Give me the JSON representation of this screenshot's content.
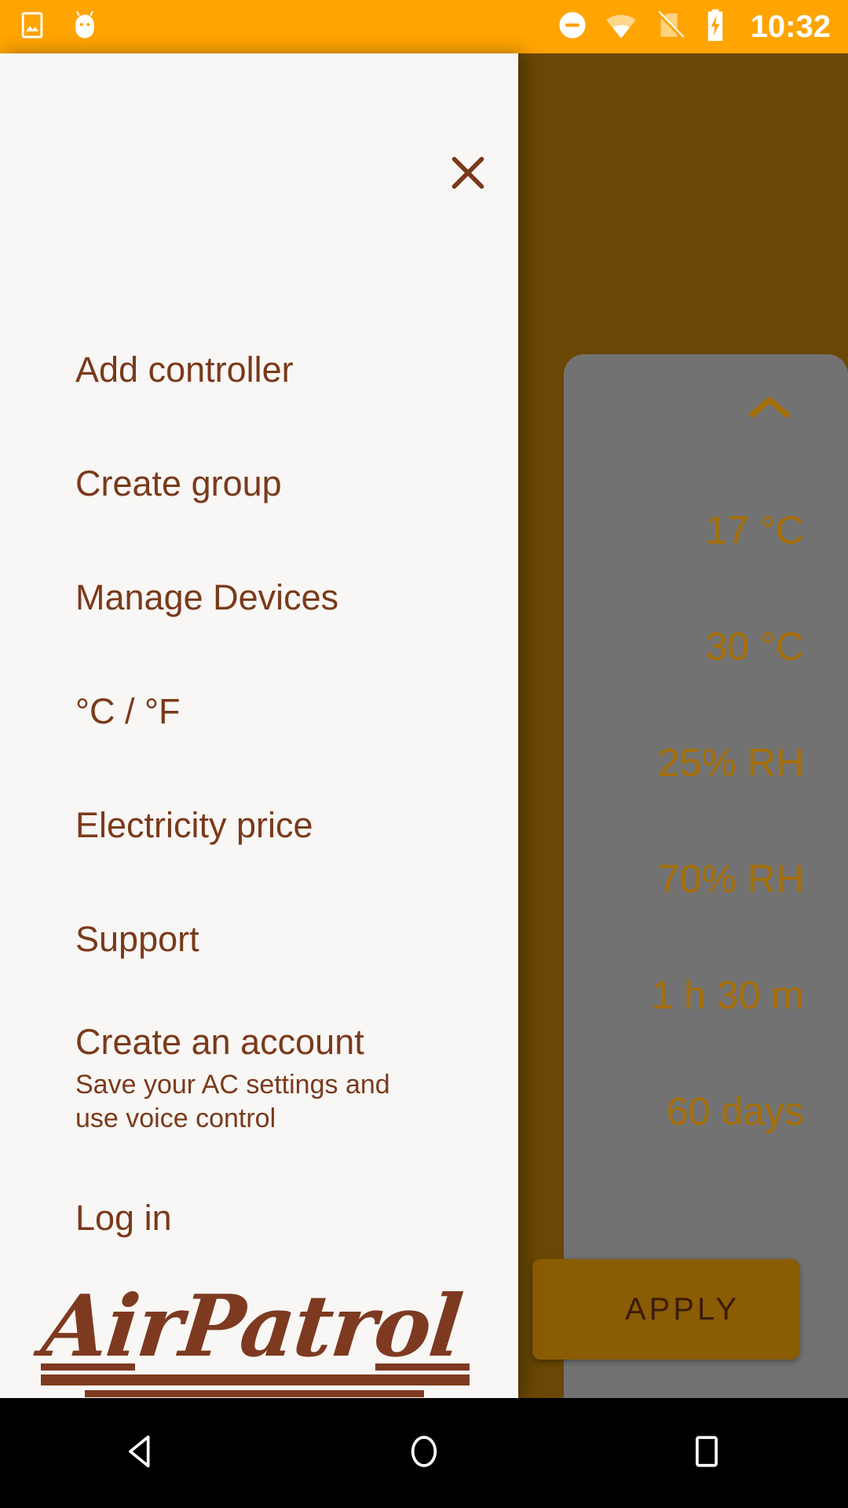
{
  "statusbar": {
    "time": "10:32",
    "icons_left": [
      "photo-icon",
      "android-head-icon"
    ],
    "icons_right": [
      "do-not-disturb-icon",
      "wifi-icon",
      "no-sim-icon",
      "battery-charging-icon"
    ],
    "background_color": "#FFA400",
    "foreground_color": "#FFFFFF"
  },
  "drawer": {
    "close_icon": "close-icon",
    "background_color": "#F8F7F5",
    "text_color": "#7A3A1B",
    "items": [
      {
        "label": "Add controller"
      },
      {
        "label": "Create group"
      },
      {
        "label": "Manage Devices"
      },
      {
        "label": "°C / °F"
      },
      {
        "label": "Electricity price"
      },
      {
        "label": "Support"
      },
      {
        "label": "Create an account",
        "sub": "Save your AC settings and use voice control"
      },
      {
        "label": "Log in"
      }
    ],
    "logo": {
      "text": "AirPatrol",
      "color": "#7E3A20"
    }
  },
  "panel": {
    "collapse_icon": "chevron-up-icon",
    "accent_color": "#A86F06",
    "card_color": "#727272",
    "scrim_color": "#6A4704",
    "values": [
      "17 °C",
      "30 °C",
      "25% RH",
      "70% RH",
      "1 h 30 m",
      "60 days"
    ],
    "apply_button": {
      "label": "APPLY",
      "background_color": "#8A5C04",
      "text_color": "#3C1C06"
    }
  },
  "navbar": {
    "back_label": "back-icon",
    "home_label": "home-icon",
    "recents_label": "recents-icon",
    "background_color": "#000000"
  }
}
